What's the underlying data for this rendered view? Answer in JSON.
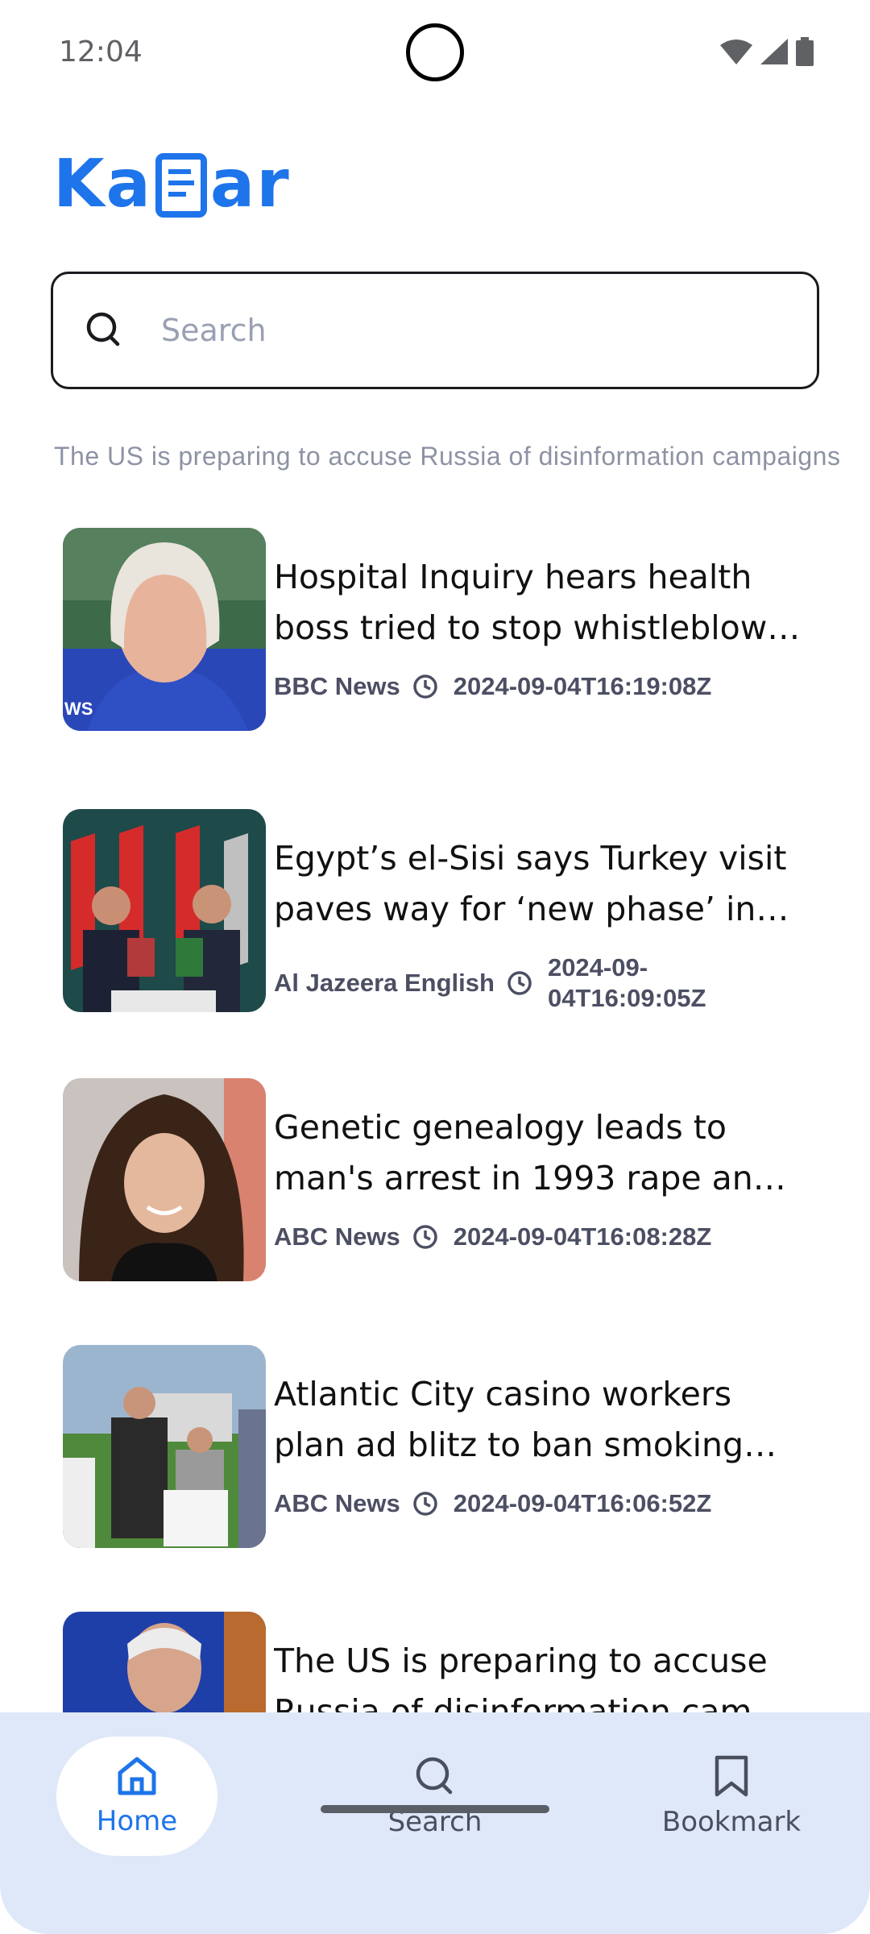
{
  "status_bar": {
    "time": "12:04"
  },
  "app": {
    "logo_text_left": "Ka",
    "logo_text_right": "ar",
    "accent_color": "#1e74ea"
  },
  "search": {
    "placeholder": "Search",
    "value": ""
  },
  "ticker": {
    "text": "The US is preparing to accuse Russia of disinformation campaigns"
  },
  "articles": [
    {
      "title": "Hospital Inquiry hears health boss tried to stop whistleblow…",
      "source": "BBC News",
      "date": "2024-09-04T16:19:08Z"
    },
    {
      "title": "Egypt’s el-Sisi says Turkey visit paves way for ‘new phase’ in r…",
      "source": "Al Jazeera English",
      "date": "2024-09-04T16:09:05Z"
    },
    {
      "title": "Genetic genealogy leads to man's arrest in 1993 rape and …",
      "source": "ABC News",
      "date": "2024-09-04T16:08:28Z"
    },
    {
      "title": "Atlantic City casino workers plan ad blitz to ban smoking a…",
      "source": "ABC News",
      "date": "2024-09-04T16:06:52Z"
    },
    {
      "title": "The US is preparing to accuse Russia of disinformation cam…",
      "source": "",
      "date": ""
    }
  ],
  "thumb_overlays": {
    "bbc_fragment": "WS"
  },
  "bottom_nav": {
    "home_label": "Home",
    "search_label": "Search",
    "bookmark_label": "Bookmark",
    "active": "Home",
    "background_color": "#dfe8f9"
  }
}
